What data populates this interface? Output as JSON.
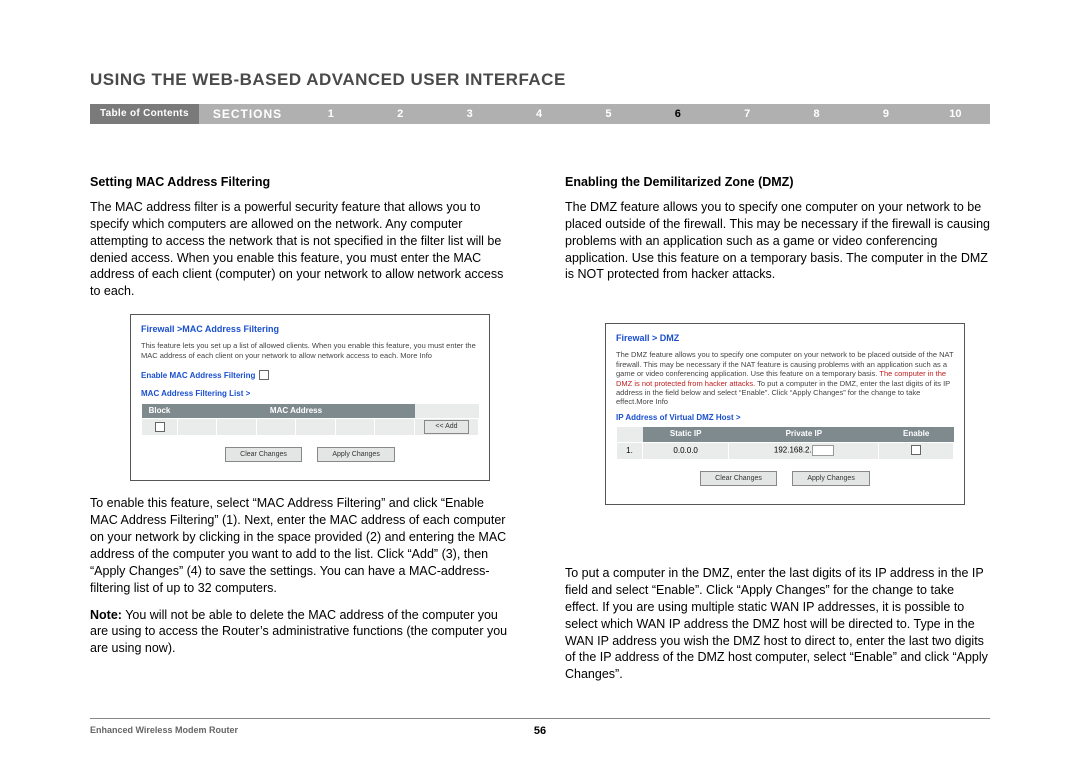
{
  "title": "USING THE WEB-BASED ADVANCED USER INTERFACE",
  "nav": {
    "toc": "Table of Contents",
    "sections": "SECTIONS",
    "items": [
      "1",
      "2",
      "3",
      "4",
      "5",
      "6",
      "7",
      "8",
      "9",
      "10"
    ],
    "active": "6"
  },
  "left": {
    "heading": "Setting MAC Address Filtering",
    "p1": "The MAC address filter is a powerful security feature that allows you to specify which computers are allowed on the network. Any computer attempting to access the network that is not specified in the filter list will be denied access. When you enable this feature, you must enter the MAC address of each client (computer) on your network to allow network access to each.",
    "panel": {
      "title": "Firewall >MAC Address Filtering",
      "desc": "This feature lets you set up a list of allowed clients. When you enable this feature, you must enter the MAC address of each client on your network to allow network access to each. More Info",
      "enable_label": "Enable MAC Address Filtering",
      "list_label": "MAC Address Filtering List >",
      "th_block": "Block",
      "th_mac": "MAC Address",
      "add_btn": "<< Add",
      "clear_btn": "Clear Changes",
      "apply_btn": "Apply Changes"
    },
    "p2": "To enable this feature, select “MAC Address Filtering” and click “Enable MAC Address Filtering” (1). Next, enter the MAC address of each computer on your network by clicking in the space provided (2) and entering the MAC address of the computer you want to add to the list. Click “Add” (3), then “Apply Changes” (4) to save the settings. You can have a MAC-address-filtering list of up to 32 computers.",
    "p3a": "Note:",
    "p3b": " You will not be able to delete the MAC address of the computer you are using to access the Router’s administrative functions (the computer you are using now)."
  },
  "right": {
    "heading": "Enabling the Demilitarized Zone (DMZ)",
    "p1": "The DMZ feature allows you to specify one computer on your network to be placed outside of the firewall. This may be necessary if the firewall is causing problems with an application such as a game or video conferencing application. Use this feature on a temporary basis. The computer in the DMZ is NOT protected from hacker attacks.",
    "panel": {
      "title": "Firewall > DMZ",
      "desc1": "The DMZ feature allows you to specify one computer on your network to be placed outside of the NAT firewall. This may be necessary if the NAT feature is causing problems with an application such as a game or video conferencing application. Use this feature on a temporary basis.",
      "desc_red": "The computer in the DMZ is not protected from hacker attacks.",
      "desc2": "To put a computer in the DMZ, enter the last digits of its IP address in the field below and select “Enable”. Click “Apply Changes” for the change to take effect.More Info",
      "ip_label": "IP Address of Virtual DMZ Host >",
      "th_static": "Static IP",
      "th_private": "Private IP",
      "th_enable": "Enable",
      "row_num": "1.",
      "row_static": "0.0.0.0",
      "row_private": "192.168.2.",
      "clear_btn": "Clear Changes",
      "apply_btn": "Apply Changes"
    },
    "p2": "To put a computer in the DMZ, enter the last digits of its IP address in the IP field and select “Enable”. Click “Apply Changes” for the change to take effect. If you are using multiple static WAN IP addresses, it is possible to select which WAN IP address the DMZ host will be directed to. Type in the WAN IP address you wish the DMZ host to direct to, enter the last two digits of the IP address of the DMZ host computer, select “Enable” and click “Apply Changes”."
  },
  "footer": {
    "product": "Enhanced Wireless Modem Router",
    "page": "56"
  }
}
